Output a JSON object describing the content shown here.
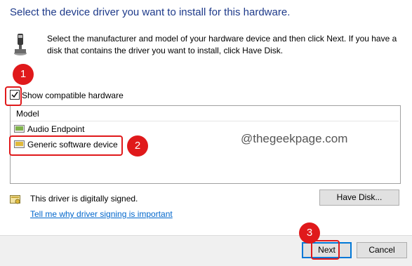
{
  "dialog": {
    "heading": "Select the device driver you want to install for this hardware.",
    "intro": "Select the manufacturer and model of your hardware device and then click Next. If you have a disk that contains the driver you want to install, click Have Disk.",
    "hardware_icon": "hardware-wizard-icon"
  },
  "compatible": {
    "label": "Show compatible hardware",
    "checked": true
  },
  "model_list": {
    "header": "Model",
    "items": [
      {
        "label": "Audio Endpoint",
        "icon": "device-icon"
      },
      {
        "label": "Generic software device",
        "icon": "device-icon"
      }
    ]
  },
  "watermark": "@thegeekpage.com",
  "signing": {
    "status": "This driver is digitally signed.",
    "link": "Tell me why driver signing is important",
    "icon": "signed-driver-icon"
  },
  "buttons": {
    "have_disk": "Have Disk...",
    "next": "Next",
    "cancel": "Cancel"
  },
  "annotations": {
    "step1": "1",
    "step2": "2",
    "step3": "3",
    "color": "#e0191b"
  }
}
